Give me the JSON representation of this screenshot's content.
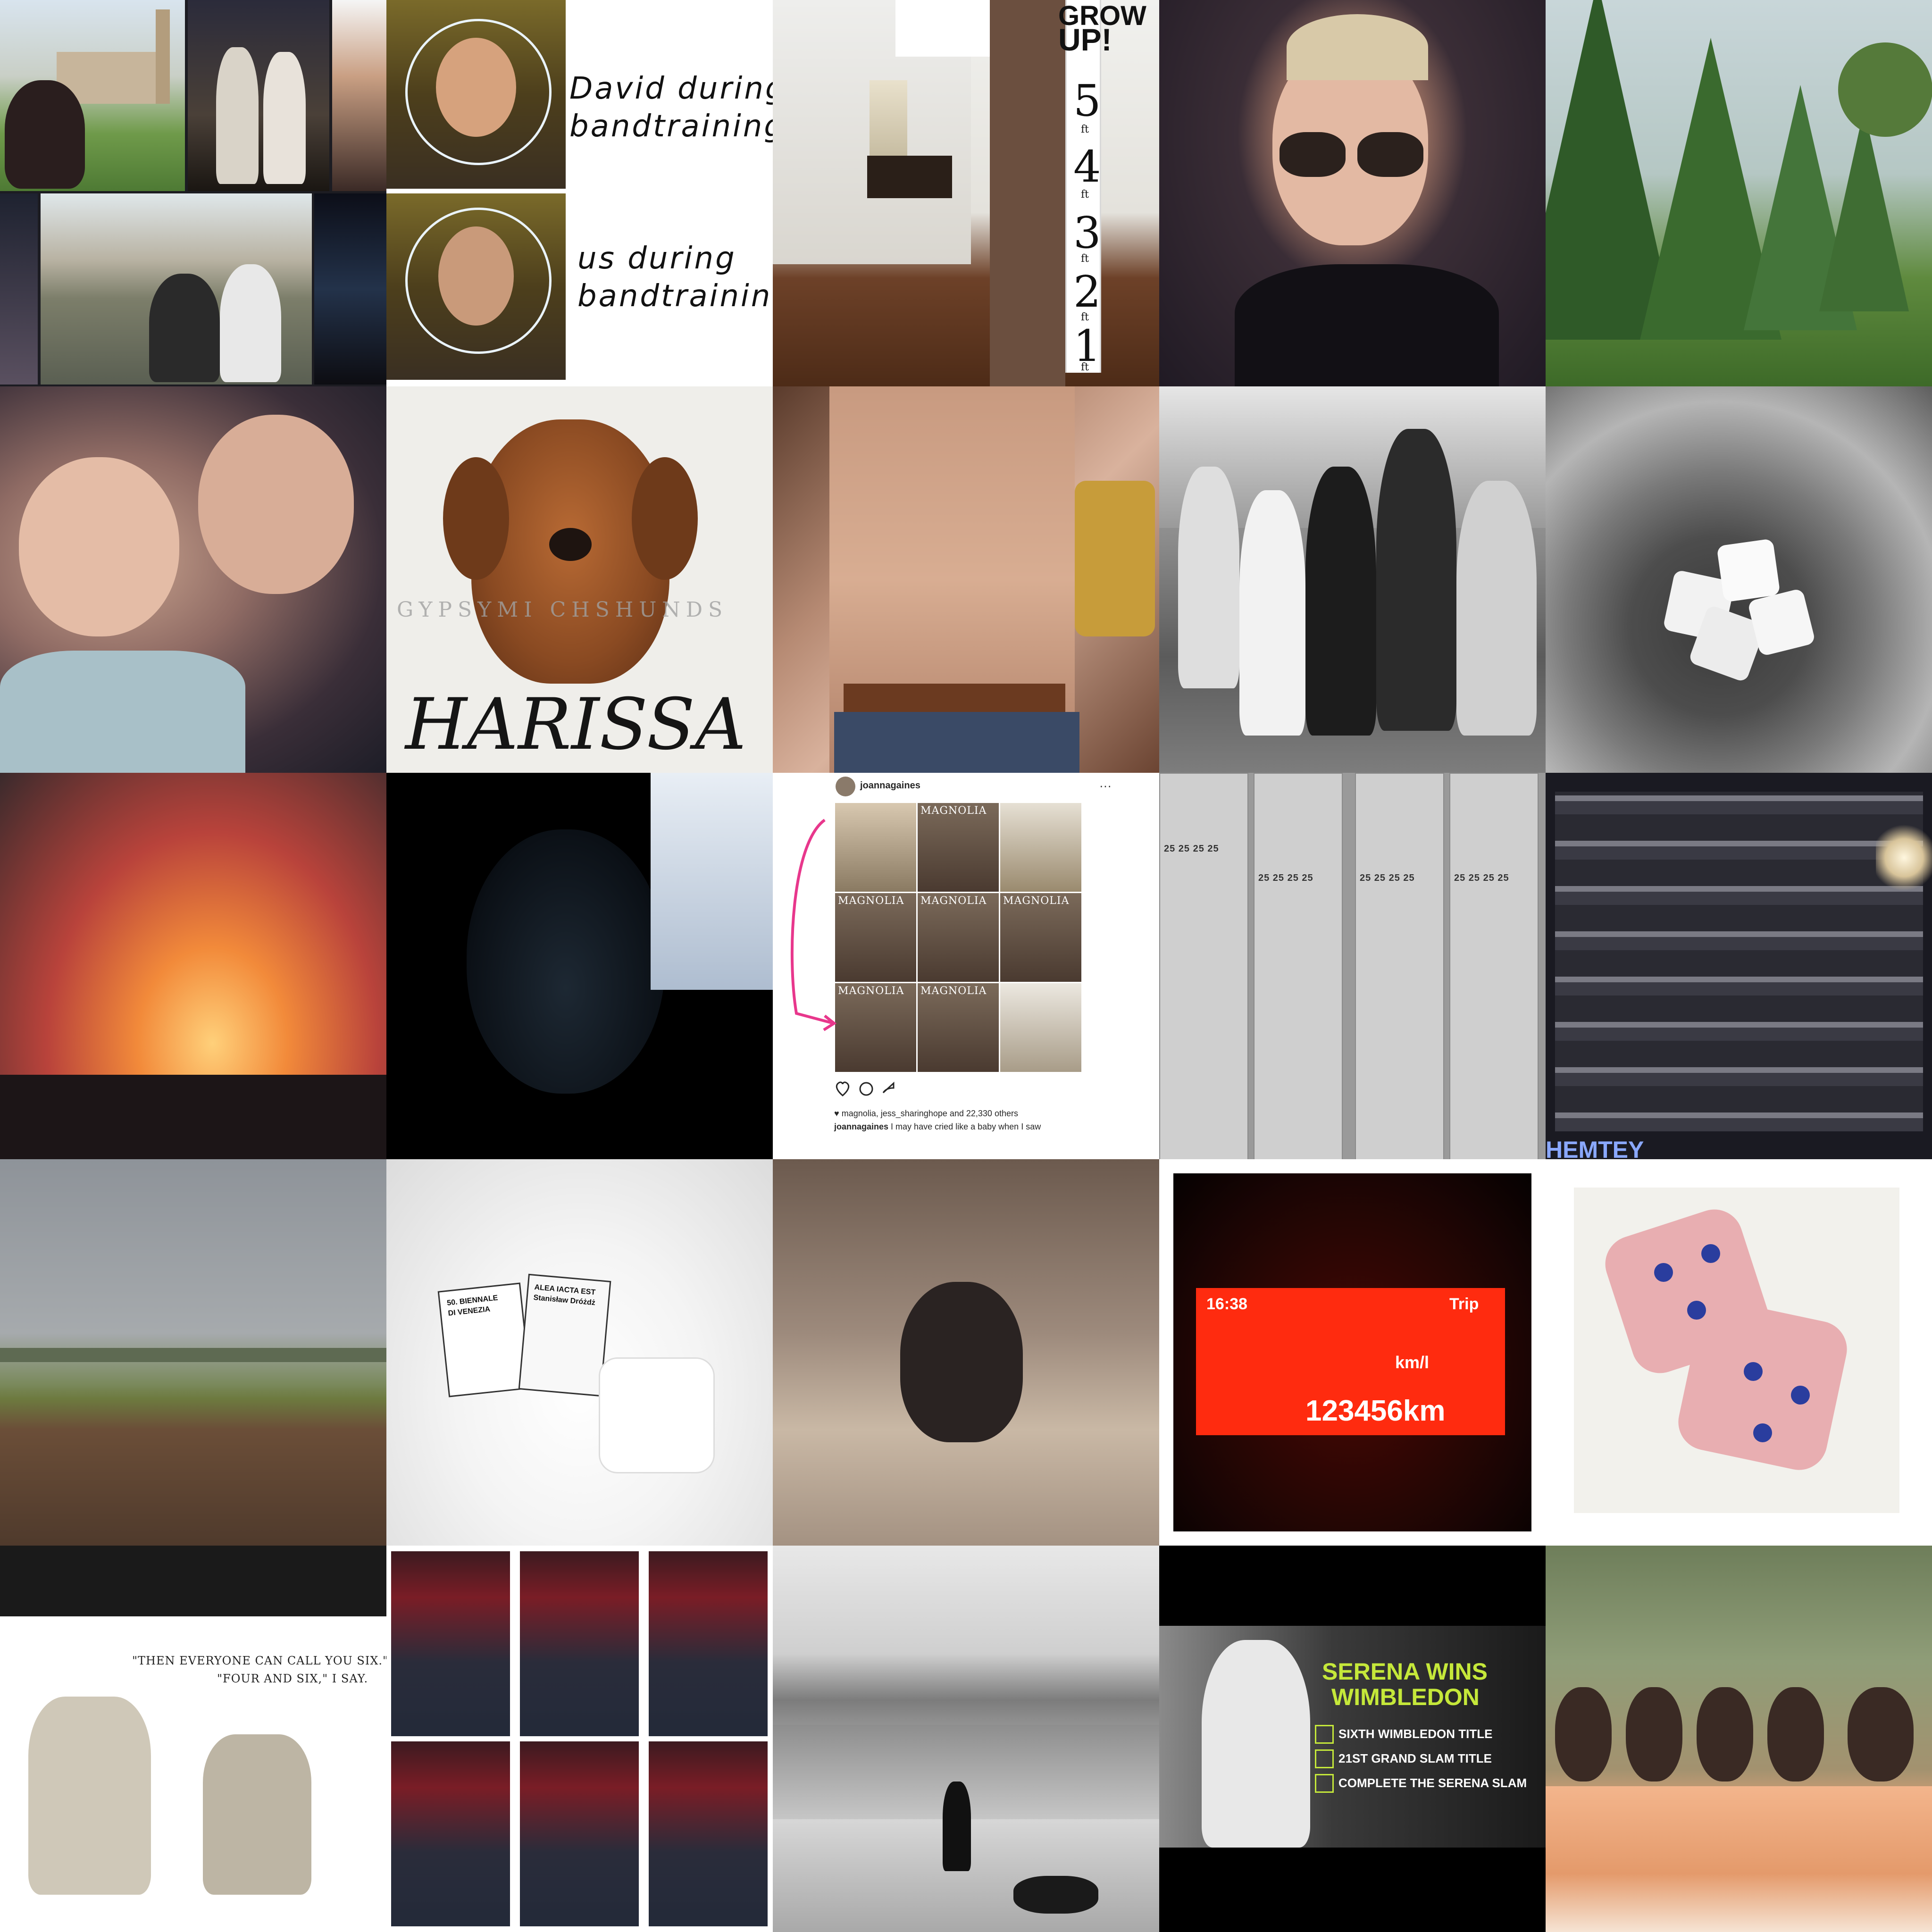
{
  "tiles": [
    {
      "id": "travel-collage",
      "caption": ""
    },
    {
      "id": "band-training",
      "text1": "David during",
      "text2": "bandtraining",
      "text3": "us during",
      "text4": "bandtraining"
    },
    {
      "id": "grow-up-ruler",
      "title1": "GROW",
      "title2": "UP!",
      "marks": [
        "5",
        "4",
        "3",
        "2",
        "1"
      ],
      "unit": "ft"
    },
    {
      "id": "sunglasses-selfie"
    },
    {
      "id": "trees"
    },
    {
      "id": "mother-child"
    },
    {
      "id": "puppy",
      "watermark": "GYPSYMI                    CHSHUNDS",
      "name": "HARISSA"
    },
    {
      "id": "shirtless-mirror-selfie"
    },
    {
      "id": "family-bw"
    },
    {
      "id": "dice-cup"
    },
    {
      "id": "concert-fire"
    },
    {
      "id": "dark-portrait"
    },
    {
      "id": "instagram-post",
      "username": "joannagaines",
      "likes": "magnolia, jess_sharinghope and 22,330 others",
      "caption_user": "joannagaines",
      "caption": "I may have cried like a baby when I saw",
      "mag_label": "MAGNOLIA"
    },
    {
      "id": "facade-daytime",
      "label": "25 25 25 25"
    },
    {
      "id": "facade-night",
      "sign": "HEMTEY"
    },
    {
      "id": "field"
    },
    {
      "id": "biennale-die",
      "box_text1": "50. BIENNALE",
      "box_text2": "DI VENEZIA",
      "box_text3": "ALEA IACTA EST",
      "box_text4": "Stanisław Dróżdż"
    },
    {
      "id": "cat"
    },
    {
      "id": "odometer",
      "time": "16:38",
      "trip": "Trip",
      "speed": "km/l",
      "odometer": "123456km"
    },
    {
      "id": "pink-dice"
    },
    {
      "id": "drawing",
      "quote1": "\"THEN EVERYONE CAN CALL YOU SIX.\"",
      "quote2": "\"FOUR AND SIX,\" I SAY."
    },
    {
      "id": "baby-collage"
    },
    {
      "id": "lake-bw"
    },
    {
      "id": "serena",
      "head1": "SERENA WINS",
      "head2": "WIMBLEDON",
      "items": [
        "SIXTH WIMBLEDON TITLE",
        "21ST GRAND SLAM TITLE",
        "COMPLETE THE SERENA SLAM"
      ]
    },
    {
      "id": "group-kids"
    }
  ]
}
